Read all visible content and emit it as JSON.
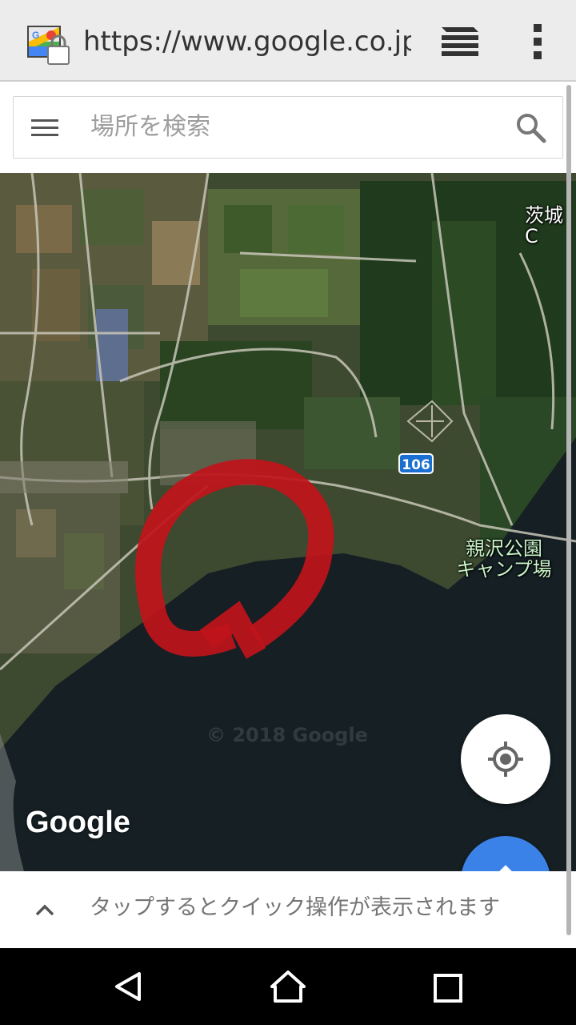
{
  "browser": {
    "url": "https://www.google.co.jp/",
    "icons": {
      "site": "maps-lock-icon",
      "tabs": "tabs-icon",
      "menu": "overflow-menu-icon"
    }
  },
  "search": {
    "placeholder": "場所を検索",
    "icons": {
      "menu": "hamburger-icon",
      "search": "search-icon"
    }
  },
  "map": {
    "labels": {
      "ibaraki": "茨城C",
      "park_line1": "親沢公園",
      "park_line2": "キャンプ場"
    },
    "route_number": "106",
    "watermark": "© 2018 Google",
    "logo": "Google",
    "annotation_color": "#c0141b",
    "buttons": {
      "location": "my-location-icon",
      "directions": "directions-icon"
    }
  },
  "quick_actions": {
    "text": "タップするとクイック操作が表示されます",
    "icon": "chevron-up-icon"
  },
  "nav": {
    "back": "back-icon",
    "home": "home-icon",
    "recents": "recents-icon"
  },
  "colors": {
    "fab_blue": "#3b82e8",
    "route_blue": "#1a6fd0"
  }
}
